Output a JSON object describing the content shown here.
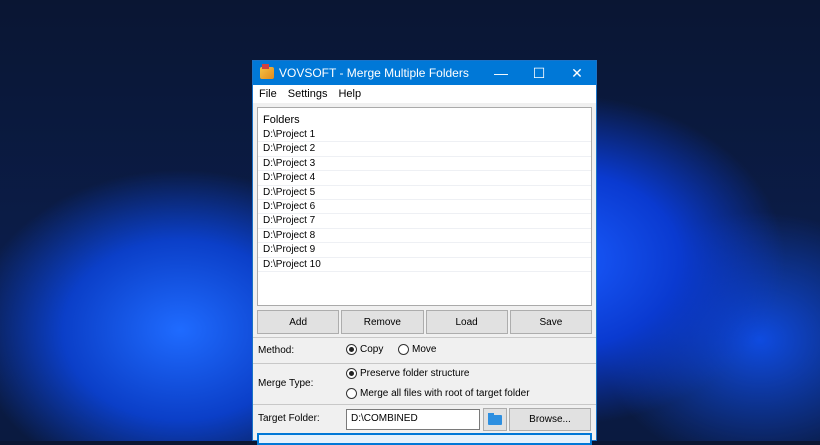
{
  "window": {
    "title": "VOVSOFT - Merge Multiple Folders",
    "minimize": "—",
    "maximize": "☐",
    "close": "✕"
  },
  "menu": [
    "File",
    "Settings",
    "Help"
  ],
  "list": {
    "header": "Folders",
    "items": [
      "D:\\Project 1",
      "D:\\Project 2",
      "D:\\Project 3",
      "D:\\Project 4",
      "D:\\Project 5",
      "D:\\Project 6",
      "D:\\Project 7",
      "D:\\Project 8",
      "D:\\Project 9",
      "D:\\Project 10"
    ]
  },
  "buttons": {
    "add": "Add",
    "remove": "Remove",
    "load": "Load",
    "save": "Save",
    "browse": "Browse..."
  },
  "method": {
    "label": "Method:",
    "copy": "Copy",
    "move": "Move",
    "selected": "Copy"
  },
  "merge_type": {
    "label": "Merge Type:",
    "preserve": "Preserve folder structure",
    "merge_root": "Merge all files with root of target folder",
    "selected": "Preserve folder structure"
  },
  "target": {
    "label": "Target Folder:",
    "value": "D:\\COMBINED"
  }
}
